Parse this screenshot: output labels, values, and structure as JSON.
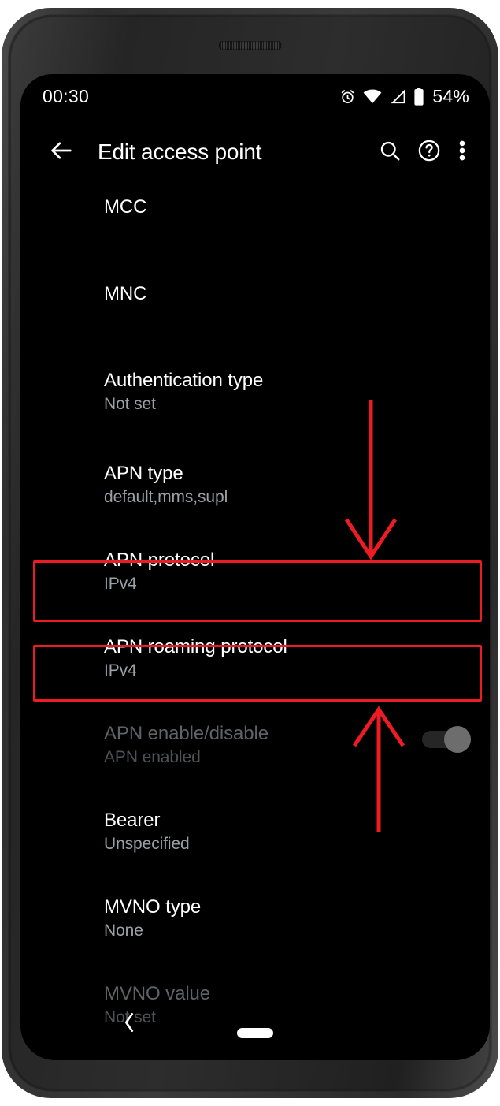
{
  "status_bar": {
    "clock": "00:30",
    "battery_percent": "54%",
    "icons": [
      "alarm-icon",
      "wifi-icon",
      "cellular-signal-icon",
      "battery-icon"
    ]
  },
  "app_bar": {
    "back_icon": "arrow-back-icon",
    "title": "Edit access point",
    "actions": [
      {
        "name": "search-icon",
        "label": "Search"
      },
      {
        "name": "help-icon",
        "label": "Help"
      },
      {
        "name": "overflow-menu-icon",
        "label": "More options"
      }
    ]
  },
  "preferences": [
    {
      "key": "mcc",
      "title": "MCC",
      "summary": "",
      "disabled": false,
      "highlighted": false,
      "has_switch": false
    },
    {
      "key": "mnc",
      "title": "MNC",
      "summary": "",
      "disabled": false,
      "highlighted": false,
      "has_switch": false
    },
    {
      "key": "auth_type",
      "title": "Authentication type",
      "summary": "Not set",
      "disabled": false,
      "highlighted": false,
      "has_switch": false
    },
    {
      "key": "apn_type",
      "title": "APN type",
      "summary": "default,mms,supl",
      "disabled": false,
      "highlighted": false,
      "has_switch": false
    },
    {
      "key": "apn_proto",
      "title": "APN protocol",
      "summary": "IPv4",
      "disabled": false,
      "highlighted": true,
      "has_switch": false
    },
    {
      "key": "apn_roam",
      "title": "APN roaming protocol",
      "summary": "IPv4",
      "disabled": false,
      "highlighted": true,
      "has_switch": false
    },
    {
      "key": "apn_enable",
      "title": "APN enable/disable",
      "summary": "APN enabled",
      "disabled": true,
      "highlighted": false,
      "has_switch": true,
      "switch_on": true
    },
    {
      "key": "bearer",
      "title": "Bearer",
      "summary": "Unspecified",
      "disabled": false,
      "highlighted": false,
      "has_switch": false
    },
    {
      "key": "mvno_type",
      "title": "MVNO type",
      "summary": "None",
      "disabled": false,
      "highlighted": false,
      "has_switch": false
    },
    {
      "key": "mvno_value",
      "title": "MVNO value",
      "summary": "Not set",
      "disabled": true,
      "highlighted": false,
      "has_switch": false
    }
  ],
  "annotations": {
    "accent_color": "#ed1c24",
    "highlight_boxes": [
      {
        "target": "APN protocol"
      },
      {
        "target": "APN roaming protocol"
      }
    ],
    "arrows": [
      {
        "name": "arrow-down-to-apn-protocol",
        "direction": "down"
      },
      {
        "name": "arrow-up-to-apn-roaming-protocol",
        "direction": "up"
      }
    ]
  },
  "nav_bar": {
    "back_icon": "nav-back-chevron-icon",
    "home_pill": "home-gesture-pill"
  }
}
